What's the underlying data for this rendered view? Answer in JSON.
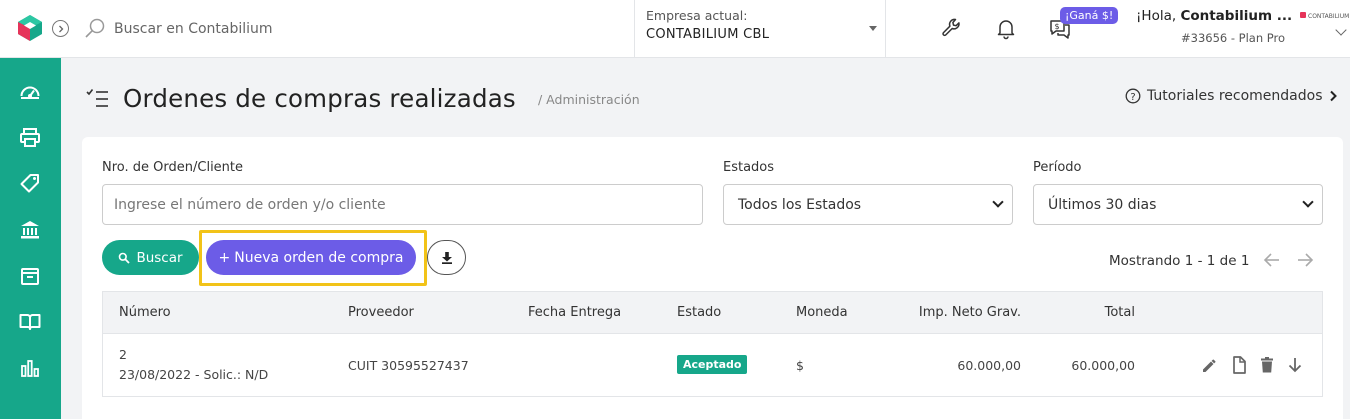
{
  "header": {
    "search_placeholder": "Buscar en Contabilium",
    "company_label": "Empresa actual:",
    "company_value": "CONTABILIUM CBL",
    "promo_badge": "¡Ganá $!",
    "greeting_prefix": "¡Hola, ",
    "greeting_name": "Contabilium ...",
    "plan": "#33656 - Plan Pro",
    "mini_logo_text": "CONTABILIUM"
  },
  "sidebar": {
    "items": [
      {
        "icon": "dashboard-icon"
      },
      {
        "icon": "printer-icon"
      },
      {
        "icon": "tag-icon"
      },
      {
        "icon": "bank-icon"
      },
      {
        "icon": "box-icon"
      },
      {
        "icon": "book-icon"
      },
      {
        "icon": "chart-icon"
      }
    ]
  },
  "page": {
    "title": "Ordenes de compras realizadas",
    "breadcrumb": "/ Administración",
    "tutorials": "Tutoriales recomendados"
  },
  "filters": {
    "order_label": "Nro. de Orden/Cliente",
    "order_placeholder": "Ingrese el número de orden y/o cliente",
    "status_label": "Estados",
    "status_value": "Todos los Estados",
    "period_label": "Período",
    "period_value": "Últimos 30 dias"
  },
  "actions": {
    "search_label": "Buscar",
    "new_order_label": "Nueva orden de compra",
    "pager_text": "Mostrando 1 - 1 de 1"
  },
  "table": {
    "headers": [
      "Número",
      "Proveedor",
      "Fecha Entrega",
      "Estado",
      "Moneda",
      "Imp. Neto Grav.",
      "Total"
    ],
    "rows": [
      {
        "numero": "2",
        "fecha_solic": "23/08/2022 - Solic.: N/D",
        "proveedor": "CUIT 30595527437",
        "fecha_entrega": "",
        "estado": "Aceptado",
        "moneda": "$",
        "neto": "60.000,00",
        "total": "60.000,00"
      }
    ]
  },
  "colors": {
    "brand_green": "#16a78a",
    "accent_purple": "#6c5ce7",
    "highlight_yellow": "#f2c318"
  }
}
